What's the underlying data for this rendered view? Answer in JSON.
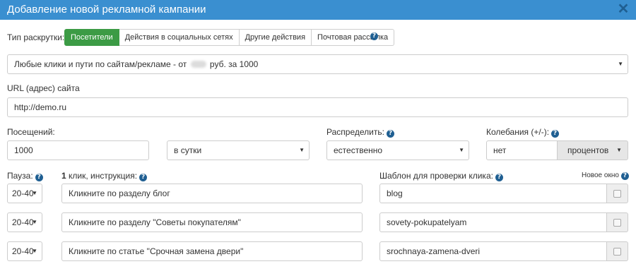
{
  "dialog": {
    "title": "Добавление новой рекламной кампании",
    "close_label": "✕"
  },
  "promo_type": {
    "label": "Тип раскрутки:",
    "tabs": [
      {
        "label": "Посетители",
        "active": true
      },
      {
        "label": "Действия в социальных сетях",
        "active": false
      },
      {
        "label": "Другие действия",
        "active": false
      },
      {
        "label": "Почтовая рассылка",
        "active": false
      }
    ]
  },
  "campaign_select": {
    "value_prefix": "Любые клики и пути по сайтам/рекламе - от",
    "value_suffix": "руб. за 1000"
  },
  "url": {
    "label": "URL (адрес) сайта",
    "value": "http://demo.ru"
  },
  "visits": {
    "label": "Посещений:",
    "value": "1000",
    "period": "в сутки"
  },
  "distribute": {
    "label": "Распределить:",
    "value": "естественно"
  },
  "fluctuation": {
    "label": "Колебания (+/-):",
    "value": "нет",
    "unit": "процентов"
  },
  "pause": {
    "label": "Пауза:"
  },
  "instruction": {
    "label_bold": "1",
    "label_rest": " клик, инструкция:"
  },
  "template": {
    "label": "Шаблон для проверки клика:",
    "new_window_label": "Новое окно"
  },
  "rows": [
    {
      "pause": "20-40",
      "instruction": "Кликните по разделу блог",
      "template": "blog",
      "new_window": false
    },
    {
      "pause": "20-40",
      "instruction": "Кликните по разделу \"Советы покупателям\"",
      "template": "sovety-pokupatelyam",
      "new_window": false
    },
    {
      "pause": "20-40",
      "instruction": "Кликните по статье \"Срочная замена двери\"",
      "template": "srochnaya-zamena-dveri",
      "new_window": false
    }
  ],
  "colors": {
    "titlebar": "#3a8fd0",
    "active_tab": "#3c9b45",
    "help_icon": "#1f5f92"
  }
}
